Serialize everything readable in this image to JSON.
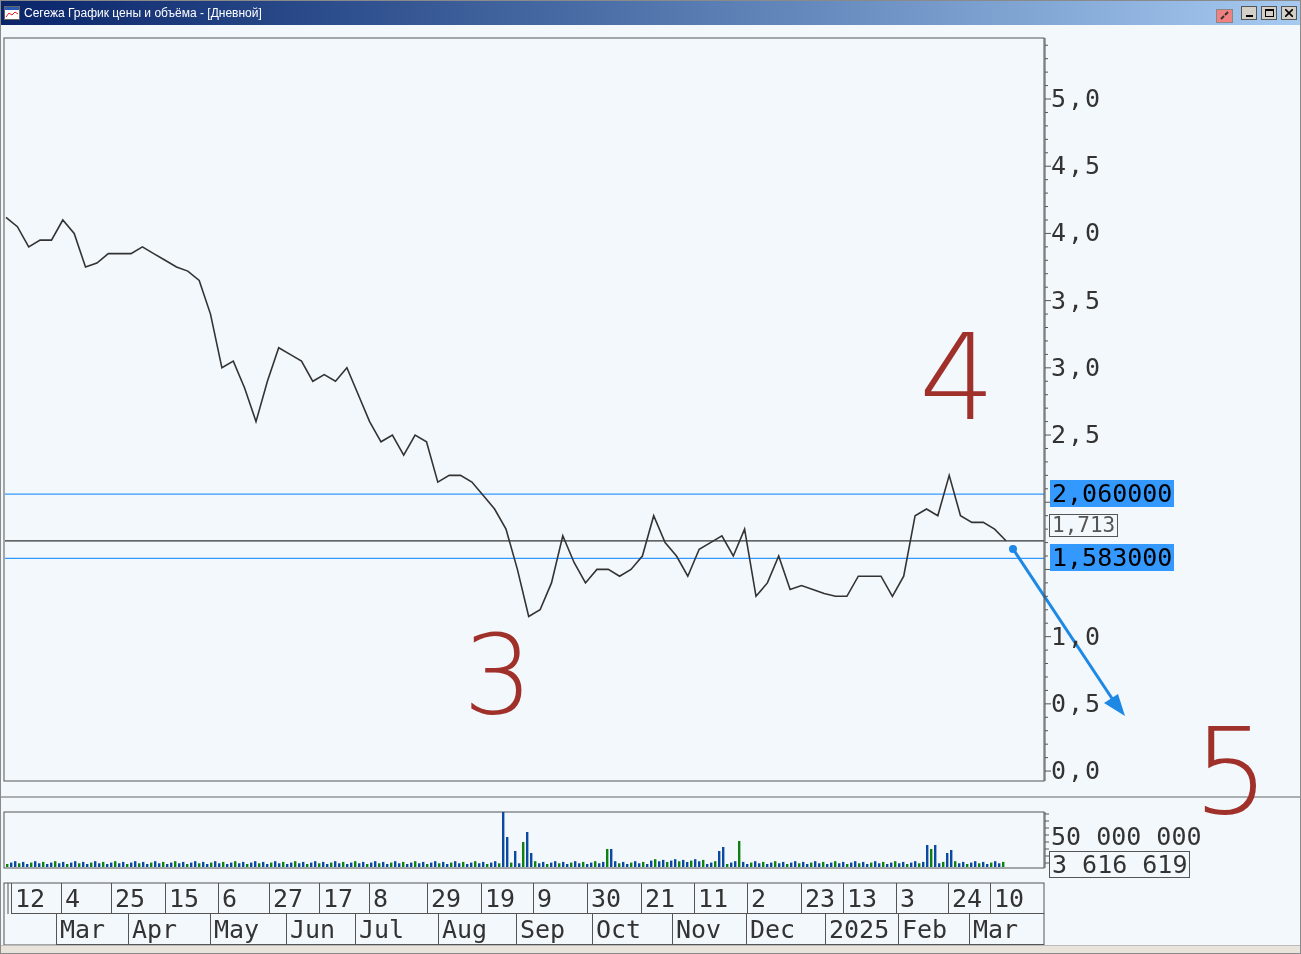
{
  "window": {
    "title": "Сегежа График цены и объёма - [Дневной]"
  },
  "price_chart": {
    "chart_data": {
      "type": "line",
      "ylim": [
        -0.074,
        5.454
      ],
      "yticks": [
        {
          "value": 0,
          "label": "0,0"
        },
        {
          "value": 0.5,
          "label": "0,5"
        },
        {
          "value": 1,
          "label": "1,0"
        },
        {
          "value": 2.5,
          "label": "2,5"
        },
        {
          "value": 3,
          "label": "3,0"
        },
        {
          "value": 3.5,
          "label": "3,5"
        },
        {
          "value": 4,
          "label": "4,0"
        },
        {
          "value": 4.5,
          "label": "4,5"
        },
        {
          "value": 5,
          "label": "5,0"
        }
      ],
      "series": [
        {
          "color": "#333333",
          "values": [
            4.12,
            4.05,
            3.9,
            3.95,
            3.95,
            4.1,
            4.0,
            3.75,
            3.78,
            3.85,
            3.85,
            3.85,
            3.9,
            3.85,
            3.8,
            3.75,
            3.72,
            3.65,
            3.4,
            3.0,
            3.05,
            2.85,
            2.6,
            2.9,
            3.15,
            3.1,
            3.05,
            2.9,
            2.95,
            2.9,
            3.0,
            2.8,
            2.6,
            2.45,
            2.5,
            2.35,
            2.5,
            2.45,
            2.15,
            2.2,
            2.2,
            2.15,
            2.05,
            1.95,
            1.8,
            1.5,
            1.15,
            1.2,
            1.4,
            1.75,
            1.55,
            1.4,
            1.5,
            1.5,
            1.45,
            1.5,
            1.6,
            1.9,
            1.7,
            1.6,
            1.45,
            1.65,
            1.7,
            1.75,
            1.6,
            1.8,
            1.3,
            1.4,
            1.6,
            1.35,
            1.38,
            1.35,
            1.32,
            1.3,
            1.3,
            1.45,
            1.45,
            1.45,
            1.3,
            1.45,
            1.9,
            1.95,
            1.9,
            2.2,
            1.9,
            1.85,
            1.85,
            1.8,
            1.713
          ]
        }
      ]
    },
    "levels": [
      {
        "kind": "drawn",
        "label": "2,060000"
      },
      {
        "kind": "last",
        "label": "1,713"
      },
      {
        "kind": "drawn",
        "label": "1,583000"
      }
    ]
  },
  "handwritten_marks": [
    {
      "text": "4"
    },
    {
      "text": "3"
    },
    {
      "text": "5"
    }
  ],
  "volume_panel": {
    "scale_label": "50 000 000",
    "current_volume": "3 616 619"
  },
  "time_axis": {
    "days": [
      "12",
      "4",
      "25",
      "15",
      "6",
      "27",
      "17",
      "8",
      "29",
      "19",
      "9",
      "30",
      "21",
      "11",
      "2",
      "23",
      "13",
      "3",
      "24",
      "10"
    ],
    "months": [
      "Mar",
      "Apr",
      "May",
      "Jun",
      "Jul",
      "Aug",
      "Sep",
      "Oct",
      "Nov",
      "Dec",
      "2025",
      "Feb",
      "Mar"
    ]
  }
}
